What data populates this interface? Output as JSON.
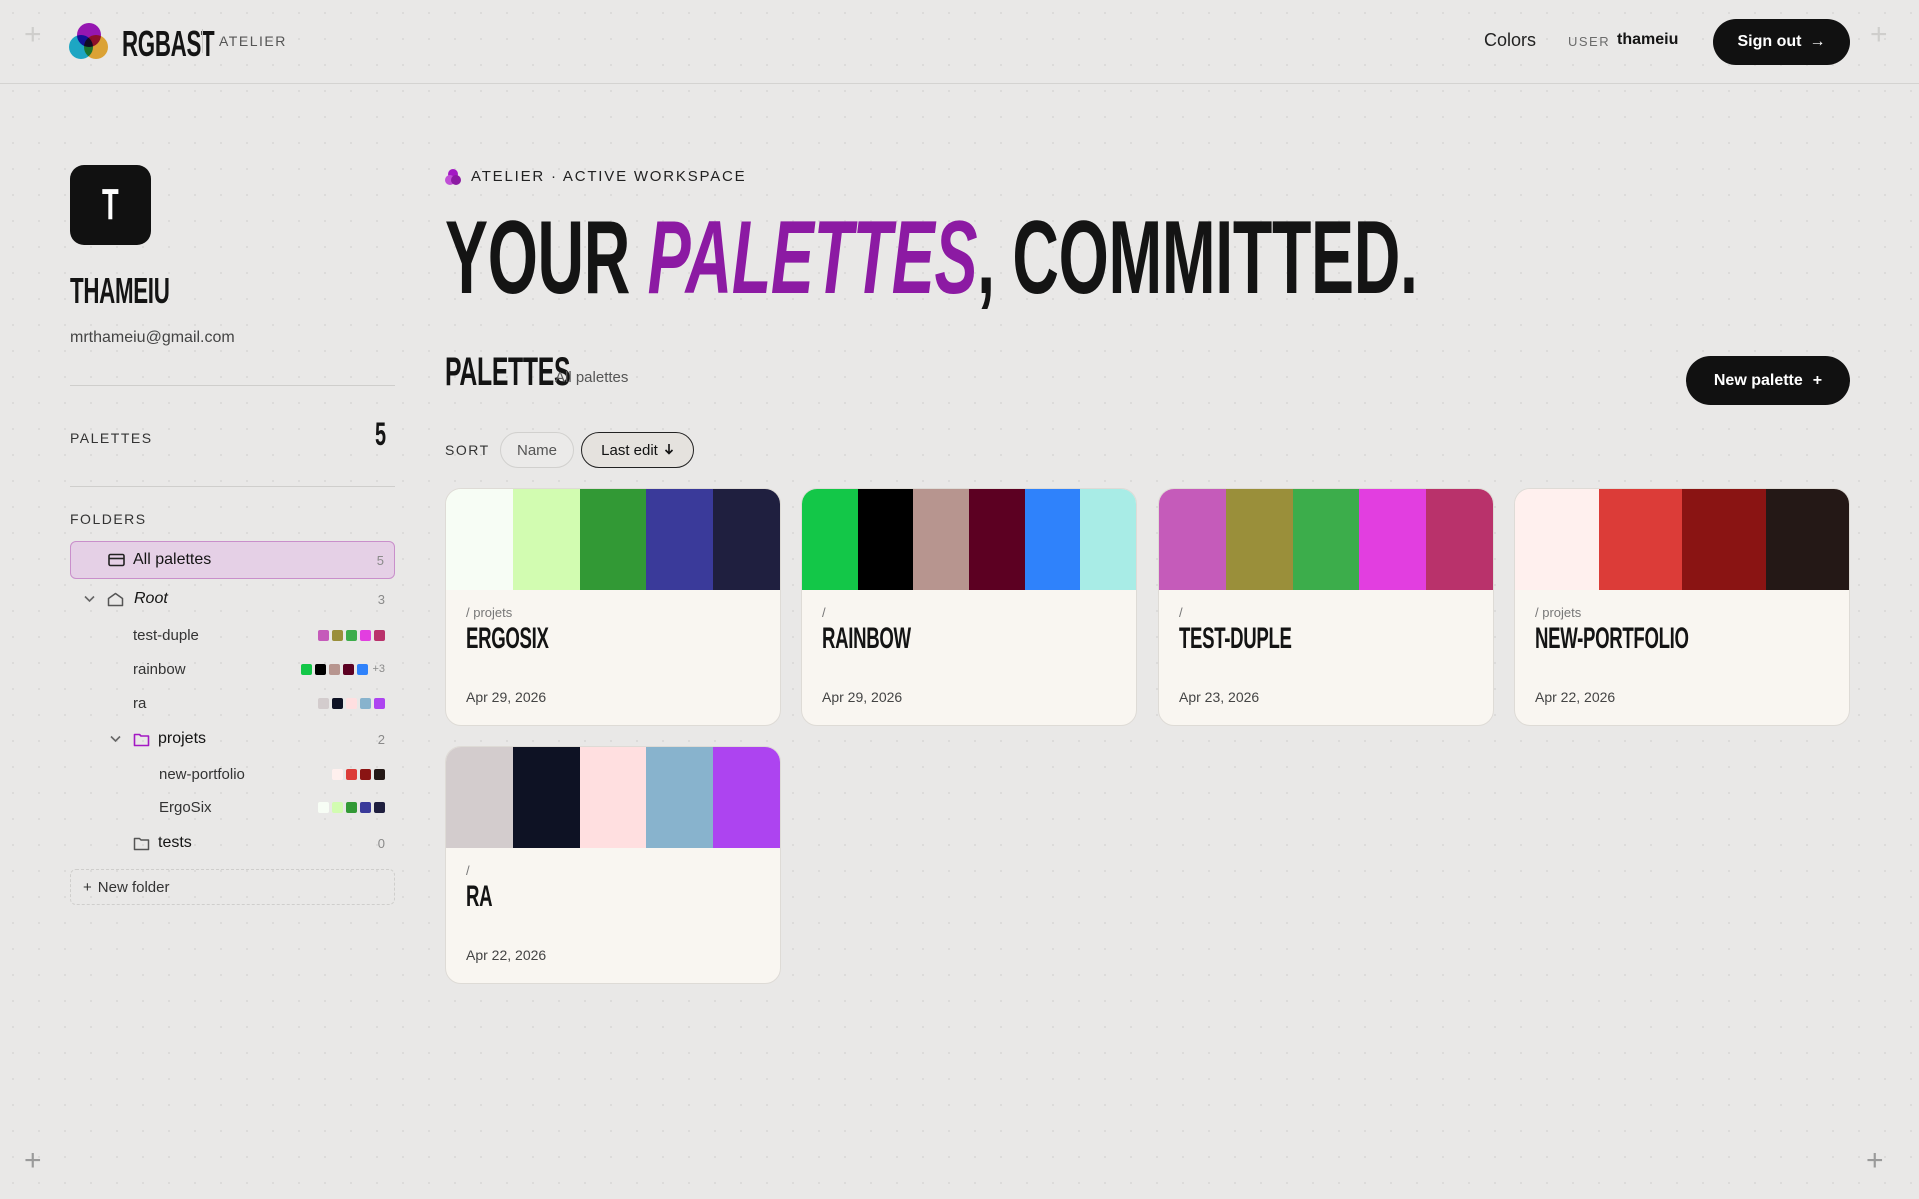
{
  "header": {
    "brand": "RGBAST",
    "brand_sub": "ATELIER",
    "nav_colors": "Colors",
    "user_label": "USER",
    "username": "thameiu",
    "signout": "Sign out",
    "signout_icon": "arrow-right-icon",
    "logo_colors": [
      "#a318c4",
      "#1fb7d8",
      "#f0b23a"
    ]
  },
  "profile": {
    "initial": "T",
    "name": "THAMEIU",
    "email": "mrthameiu@gmail.com",
    "palettes_label": "PALETTES",
    "palettes_count": "5"
  },
  "folders": {
    "label": "FOLDERS",
    "all": {
      "label": "All palettes",
      "count": "5"
    },
    "root": {
      "label": "Root",
      "count": "3"
    },
    "items": [
      {
        "label": "test-duple",
        "swatches": [
          "#c55bba",
          "#9a8f3a",
          "#3cad4b",
          "#e23ee0",
          "#b9326b"
        ],
        "more": ""
      },
      {
        "label": "rainbow",
        "swatches": [
          "#13c748",
          "#000000",
          "#b7958f",
          "#5c0022",
          "#2f82fb"
        ],
        "more": "+3"
      },
      {
        "label": "ra",
        "swatches": [
          "#d3cccd",
          "#0e1224",
          "#ffdfe0",
          "#88b3cd",
          "#ad44f0"
        ],
        "more": ""
      }
    ],
    "projets": {
      "label": "projets",
      "count": "2"
    },
    "projets_items": [
      {
        "label": "new-portfolio",
        "swatches": [
          "#fff0ee",
          "#dc3c38",
          "#8a1413",
          "#241816"
        ]
      },
      {
        "label": "ErgoSix",
        "swatches": [
          "#f7fdf5",
          "#d2fcb1",
          "#329935",
          "#3a3a9a",
          "#1f1f3f"
        ]
      }
    ],
    "tests": {
      "label": "tests",
      "count": "0"
    },
    "new_folder": "New folder"
  },
  "main": {
    "eyebrow": "ATELIER · ACTIVE WORKSPACE",
    "hero_a": "YOUR ",
    "hero_accent": "PALETTES",
    "hero_b": ", COMMITTED.",
    "section_title": "PALETTES",
    "section_sub": "All palettes",
    "new_palette": "New palette",
    "sort_label": "SORT",
    "sort_name": "Name",
    "sort_last": "Last edit",
    "accent_color": "#8c1aa3"
  },
  "cards": [
    {
      "path": "/ projets",
      "title": "ERGOSIX",
      "date": "Apr 29, 2026",
      "colors": [
        "#f7fdf5",
        "#d2fcb1",
        "#329935",
        "#3a3a9a",
        "#1f1f3f"
      ]
    },
    {
      "path": "/",
      "title": "RAINBOW",
      "date": "Apr 29, 2026",
      "colors": [
        "#13c748",
        "#000000",
        "#b7958f",
        "#5c0022",
        "#2f82fb",
        "#a8ece6"
      ]
    },
    {
      "path": "/",
      "title": "TEST-DUPLE",
      "date": "Apr 23, 2026",
      "colors": [
        "#c55bba",
        "#9a8f3a",
        "#3cad4b",
        "#e23ee0",
        "#b9326b"
      ]
    },
    {
      "path": "/ projets",
      "title": "NEW-PORTFOLIO",
      "date": "Apr 22, 2026",
      "colors": [
        "#fff0ee",
        "#dc3c38",
        "#8a1413",
        "#241816"
      ]
    },
    {
      "path": "/",
      "title": "RA",
      "date": "Apr 22, 2026",
      "colors": [
        "#d3cccd",
        "#0e1224",
        "#ffdfe0",
        "#88b3cd",
        "#ad44f0"
      ]
    }
  ]
}
